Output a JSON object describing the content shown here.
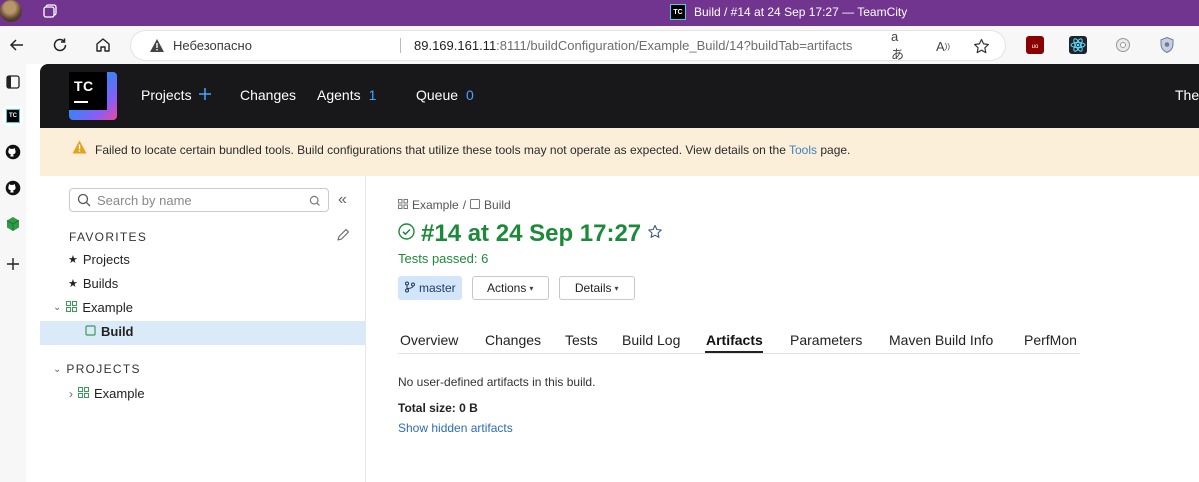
{
  "window": {
    "title": "Build / #14 at 24 Sep 17:27 — TeamCity",
    "icons": [
      "profile-avatar",
      "tab-actions-icon",
      "teamcity-favicon"
    ]
  },
  "browser": {
    "insecure_label": "Небезопасно",
    "url_host": "89.169.161.11",
    "url_rest": ":8111/buildConfiguration/Example_Build/14?buildTab=artifacts",
    "nav_icons": [
      "back-icon",
      "reload-icon",
      "home-icon"
    ],
    "address_icons": [
      "translate-icon",
      "read-aloud-icon",
      "favorite-star-icon"
    ],
    "extensions": [
      "ublock-icon",
      "react-devtools-icon",
      "extension-icon",
      "shield-extension-icon"
    ],
    "sidebar_icons": [
      "tab-icon",
      "teamcity-icon",
      "github-icon",
      "github-icon-2",
      "cube-icon",
      "add-icon"
    ]
  },
  "header": {
    "nav": [
      {
        "label": "Projects"
      },
      {
        "label": "Changes"
      },
      {
        "label": "Agents",
        "count": "1"
      },
      {
        "label": "Queue",
        "count": "0"
      }
    ],
    "right_text": "The",
    "accent": "#4aa3ff"
  },
  "banner": {
    "message": "Failed to locate certain bundled tools. Build configurations that utilize these tools may not operate as expected. View details on the",
    "link": "Tools",
    "suffix": "page.",
    "bg_color": "#fcefd9",
    "icon_color": "#e3a21a"
  },
  "sidebar": {
    "search_placeholder": "Search by name",
    "favorites_label": "FAVORITES",
    "favorites": [
      {
        "label": "Projects"
      },
      {
        "label": "Builds"
      },
      {
        "label": "Example"
      },
      {
        "label": "Build"
      }
    ],
    "projects_label": "PROJECTS",
    "projects": [
      {
        "label": "Example"
      }
    ],
    "selected_bg": "#dbeaf9"
  },
  "main": {
    "breadcrumb": {
      "project": "Example",
      "separator": "/",
      "config": "Build"
    },
    "title": "#14 at 24 Sep 17:27",
    "status": "success",
    "status_color": "#1d8a3a",
    "tests_passed": "Tests passed: 6",
    "branch": "master",
    "actions_label": "Actions",
    "details_label": "Details",
    "tabs": [
      "Overview",
      "Changes",
      "Tests",
      "Build Log",
      "Artifacts",
      "Parameters",
      "Maven Build Info",
      "PerfMon"
    ],
    "active_tab": "Artifacts",
    "artifacts_note": "No user-defined artifacts in this build.",
    "total_size": "Total size: 0 B",
    "hidden_link": "Show hidden artifacts"
  }
}
